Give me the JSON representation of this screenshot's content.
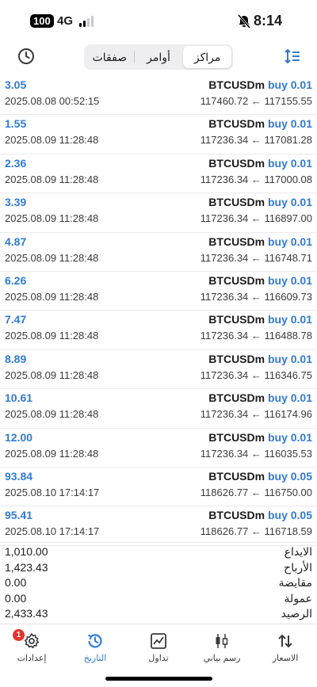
{
  "status_bar": {
    "battery": "100",
    "network": "4G",
    "time": "8:14"
  },
  "tabs": [
    {
      "label": "مراكز",
      "active": true
    },
    {
      "label": "أوامر",
      "active": false
    },
    {
      "label": "صفقات",
      "active": false
    }
  ],
  "deals": [
    {
      "profit": "3.05",
      "time": "2025.08.08 00:52:15",
      "symbol": "BTCUSDm",
      "side": "buy 0.01",
      "prices": "117460.72 ← 117155.55"
    },
    {
      "profit": "1.55",
      "time": "2025.08.09 11:28:48",
      "symbol": "BTCUSDm",
      "side": "buy 0.01",
      "prices": "117236.34 ← 117081.28"
    },
    {
      "profit": "2.36",
      "time": "2025.08.09 11:28:48",
      "symbol": "BTCUSDm",
      "side": "buy 0.01",
      "prices": "117236.34 ← 117000.08"
    },
    {
      "profit": "3.39",
      "time": "2025.08.09 11:28:48",
      "symbol": "BTCUSDm",
      "side": "buy 0.01",
      "prices": "117236.34 ← 116897.00"
    },
    {
      "profit": "4.87",
      "time": "2025.08.09 11:28:48",
      "symbol": "BTCUSDm",
      "side": "buy 0.01",
      "prices": "117236.34 ← 116748.71"
    },
    {
      "profit": "6.26",
      "time": "2025.08.09 11:28:48",
      "symbol": "BTCUSDm",
      "side": "buy 0.01",
      "prices": "117236.34 ← 116609.73"
    },
    {
      "profit": "7.47",
      "time": "2025.08.09 11:28:48",
      "symbol": "BTCUSDm",
      "side": "buy 0.01",
      "prices": "117236.34 ← 116488.78"
    },
    {
      "profit": "8.89",
      "time": "2025.08.09 11:28:48",
      "symbol": "BTCUSDm",
      "side": "buy 0.01",
      "prices": "117236.34 ← 116346.75"
    },
    {
      "profit": "10.61",
      "time": "2025.08.09 11:28:48",
      "symbol": "BTCUSDm",
      "side": "buy 0.01",
      "prices": "117236.34 ← 116174.96"
    },
    {
      "profit": "12.00",
      "time": "2025.08.09 11:28:48",
      "symbol": "BTCUSDm",
      "side": "buy 0.01",
      "prices": "117236.34 ← 116035.53"
    },
    {
      "profit": "93.84",
      "time": "2025.08.10 17:14:17",
      "symbol": "BTCUSDm",
      "side": "buy 0.05",
      "prices": "118626.77 ← 116750.00"
    },
    {
      "profit": "95.41",
      "time": "2025.08.10 17:14:17",
      "symbol": "BTCUSDm",
      "side": "buy 0.05",
      "prices": "118626.77 ← 116718.59"
    }
  ],
  "summary": [
    {
      "label": "الايداع",
      "value": "1,010.00"
    },
    {
      "label": "الأرباح",
      "value": "1,423.43"
    },
    {
      "label": "مقايضة",
      "value": "0.00"
    },
    {
      "label": "عمولة",
      "value": "0.00"
    },
    {
      "label": "الرصيد",
      "value": "2,433.43"
    }
  ],
  "nav": {
    "quotes": "الاسعار",
    "chart": "رسم بياني",
    "trade": "تداول",
    "history": "التاريخ",
    "settings": "إعدادات",
    "settings_badge": "1"
  },
  "colors": {
    "accent": "#2f7bd6",
    "badge": "#e5332a"
  },
  "icons": {
    "toolbar_left": "history-clock-icon",
    "toolbar_right": "sort-icon"
  }
}
